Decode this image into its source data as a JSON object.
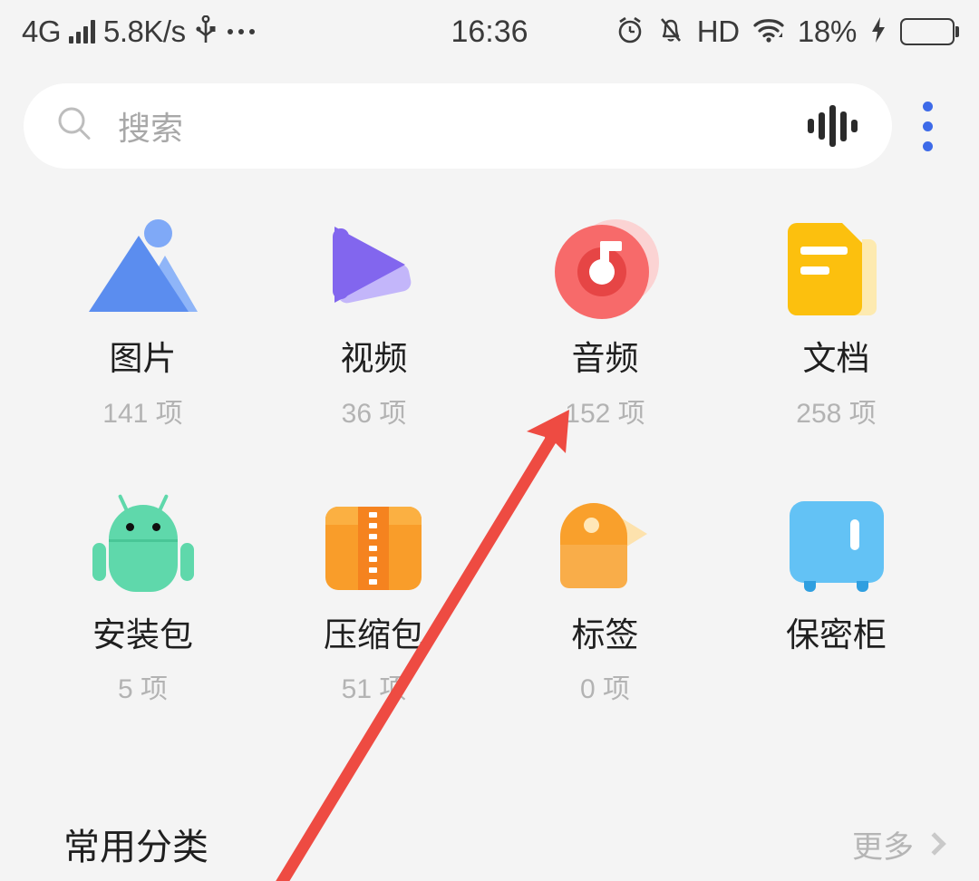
{
  "status_bar": {
    "network_type": "4G",
    "signal_icon": "signal-bars-icon",
    "network_speed": "5.8K/s",
    "usb_icon": "usb-icon",
    "more_icon": "ellipsis-icon",
    "time": "16:36",
    "alarm_icon": "alarm-clock-icon",
    "silent_icon": "bell-muted-icon",
    "hd_label": "HD",
    "wifi_icon": "wifi-icon",
    "battery_percent": "18%",
    "charging_icon": "lightning-bolt-icon",
    "battery_level": 18
  },
  "search": {
    "icon": "search-icon",
    "placeholder": "搜索",
    "voice_icon": "voice-waveform-icon",
    "overflow_icon": "three-dots-vertical-icon",
    "accent_color": "#3d6ae8"
  },
  "categories": [
    {
      "id": "pictures",
      "icon": "image-mountain-icon",
      "label": "图片",
      "count": "141 项",
      "color": "#5b8def"
    },
    {
      "id": "videos",
      "icon": "play-triangle-icon",
      "label": "视频",
      "count": "36 项",
      "color": "#8266ee"
    },
    {
      "id": "audio",
      "icon": "music-disc-icon",
      "label": "音频",
      "count": "152 项",
      "color": "#f76a6a"
    },
    {
      "id": "documents",
      "icon": "document-icon",
      "label": "文档",
      "count": "258 项",
      "color": "#fcc00e"
    },
    {
      "id": "apk",
      "icon": "android-robot-icon",
      "label": "安装包",
      "count": "5 项",
      "color": "#5fd8ab"
    },
    {
      "id": "archives",
      "icon": "zip-box-icon",
      "label": "压缩包",
      "count": "51 项",
      "color": "#f99d2a"
    },
    {
      "id": "tags",
      "icon": "price-tag-icon",
      "label": "标签",
      "count": "0 项",
      "color": "#f9a02c"
    },
    {
      "id": "safe",
      "icon": "safe-box-icon",
      "label": "保密柜",
      "count": "",
      "color": "#63c2f5"
    }
  ],
  "section": {
    "title": "常用分类",
    "more_label": "更多",
    "chevron_icon": "chevron-right-icon"
  },
  "annotation": {
    "type": "arrow",
    "color": "#ee4b42",
    "points_to": "音频"
  }
}
